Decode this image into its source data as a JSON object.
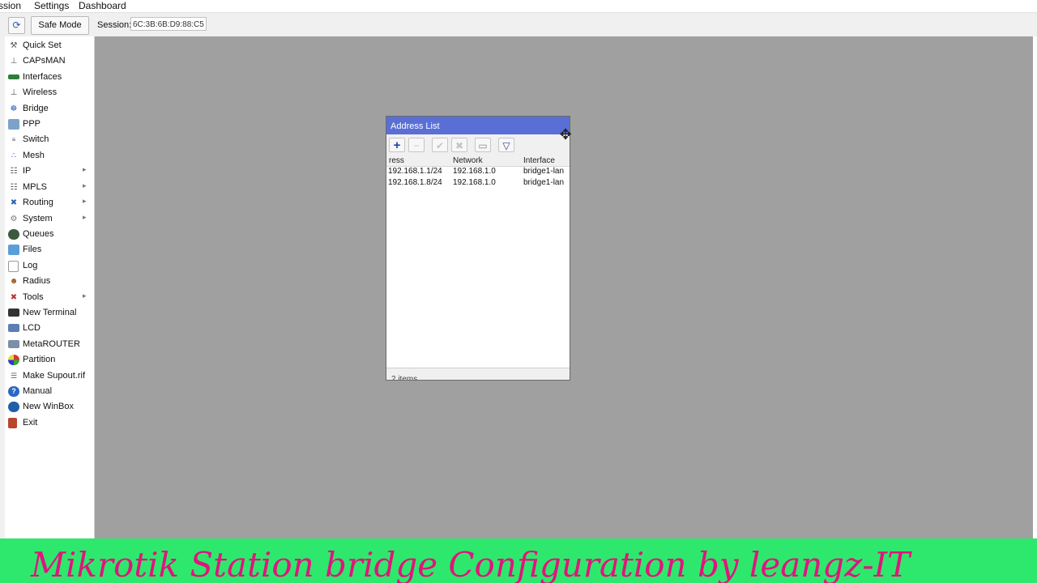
{
  "menubar": {
    "items": [
      "ssion",
      "Settings",
      "Dashboard"
    ]
  },
  "toolbar": {
    "refresh_icon": "refresh-icon",
    "safe_mode": "Safe Mode",
    "session_label": "Session:",
    "session_value": "6C:3B:6B:D9:88:C5"
  },
  "sidebar": {
    "items": [
      {
        "label": "Quick Set",
        "icon": "quick-set-icon",
        "submenu": false
      },
      {
        "label": "CAPsMAN",
        "icon": "capsman-icon",
        "submenu": false
      },
      {
        "label": "Interfaces",
        "icon": "interfaces-icon",
        "submenu": false
      },
      {
        "label": "Wireless",
        "icon": "wireless-icon",
        "submenu": false
      },
      {
        "label": "Bridge",
        "icon": "bridge-icon",
        "submenu": false
      },
      {
        "label": "PPP",
        "icon": "ppp-icon",
        "submenu": false
      },
      {
        "label": "Switch",
        "icon": "switch-icon",
        "submenu": false
      },
      {
        "label": "Mesh",
        "icon": "mesh-icon",
        "submenu": false
      },
      {
        "label": "IP",
        "icon": "ip-icon",
        "submenu": true
      },
      {
        "label": "MPLS",
        "icon": "mpls-icon",
        "submenu": true
      },
      {
        "label": "Routing",
        "icon": "routing-icon",
        "submenu": true
      },
      {
        "label": "System",
        "icon": "system-icon",
        "submenu": true
      },
      {
        "label": "Queues",
        "icon": "queues-icon",
        "submenu": false
      },
      {
        "label": "Files",
        "icon": "files-icon",
        "submenu": false
      },
      {
        "label": "Log",
        "icon": "log-icon",
        "submenu": false
      },
      {
        "label": "Radius",
        "icon": "radius-icon",
        "submenu": false
      },
      {
        "label": "Tools",
        "icon": "tools-icon",
        "submenu": true
      },
      {
        "label": "New Terminal",
        "icon": "terminal-icon",
        "submenu": false
      },
      {
        "label": "LCD",
        "icon": "lcd-icon",
        "submenu": false
      },
      {
        "label": "MetaROUTER",
        "icon": "metarouter-icon",
        "submenu": false
      },
      {
        "label": "Partition",
        "icon": "partition-icon",
        "submenu": false
      },
      {
        "label": "Make Supout.rif",
        "icon": "supout-icon",
        "submenu": false
      },
      {
        "label": "Manual",
        "icon": "manual-icon",
        "submenu": false
      },
      {
        "label": "New WinBox",
        "icon": "winbox-icon",
        "submenu": false
      },
      {
        "label": "Exit",
        "icon": "exit-icon",
        "submenu": false
      }
    ]
  },
  "address_list": {
    "title": "Address List",
    "columns": [
      "ress",
      "Network",
      "Interface"
    ],
    "rows": [
      {
        "address": "192.168.1.1/24",
        "network": "192.168.1.0",
        "interface": "bridge1-lan"
      },
      {
        "address": "192.168.1.8/24",
        "network": "192.168.1.0",
        "interface": "bridge1-lan"
      }
    ],
    "status": "2 items",
    "tool_icons": [
      "add-icon",
      "remove-icon",
      "enable-icon",
      "disable-icon",
      "comment-icon",
      "filter-icon"
    ]
  },
  "banner": {
    "text": "Mikrotik Station bridge Configuration by leangz-IT"
  },
  "colors": {
    "title_bar": "#5a6fd6",
    "desktop": "#a0a0a0",
    "banner_bg": "#2ee86e",
    "banner_text": "#e0157c"
  }
}
